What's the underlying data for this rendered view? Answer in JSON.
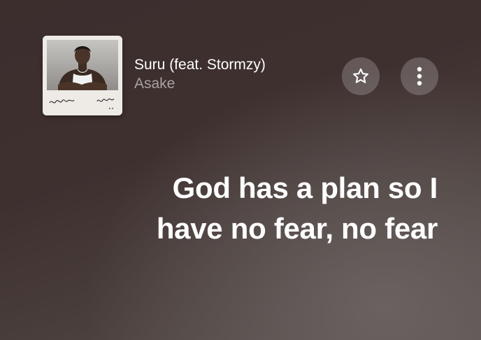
{
  "now_playing": {
    "title": "Suru (feat. Stormzy)",
    "artist": "Asake",
    "artwork": {
      "signature_left": "lungu Boy",
      "signature_right": "Asake"
    }
  },
  "controls": {
    "favorite_icon": "star-icon",
    "more_icon": "more-vertical-icon"
  },
  "lyrics": {
    "current_line": "God has a plan so I have no fear, no fear"
  },
  "colors": {
    "background_dark": "#3b2e2d",
    "background_light": "#6a6260",
    "button_fill": "rgba(255,255,255,0.2)",
    "text_primary": "#ffffff",
    "text_secondary": "rgba(255,255,255,0.55)"
  }
}
